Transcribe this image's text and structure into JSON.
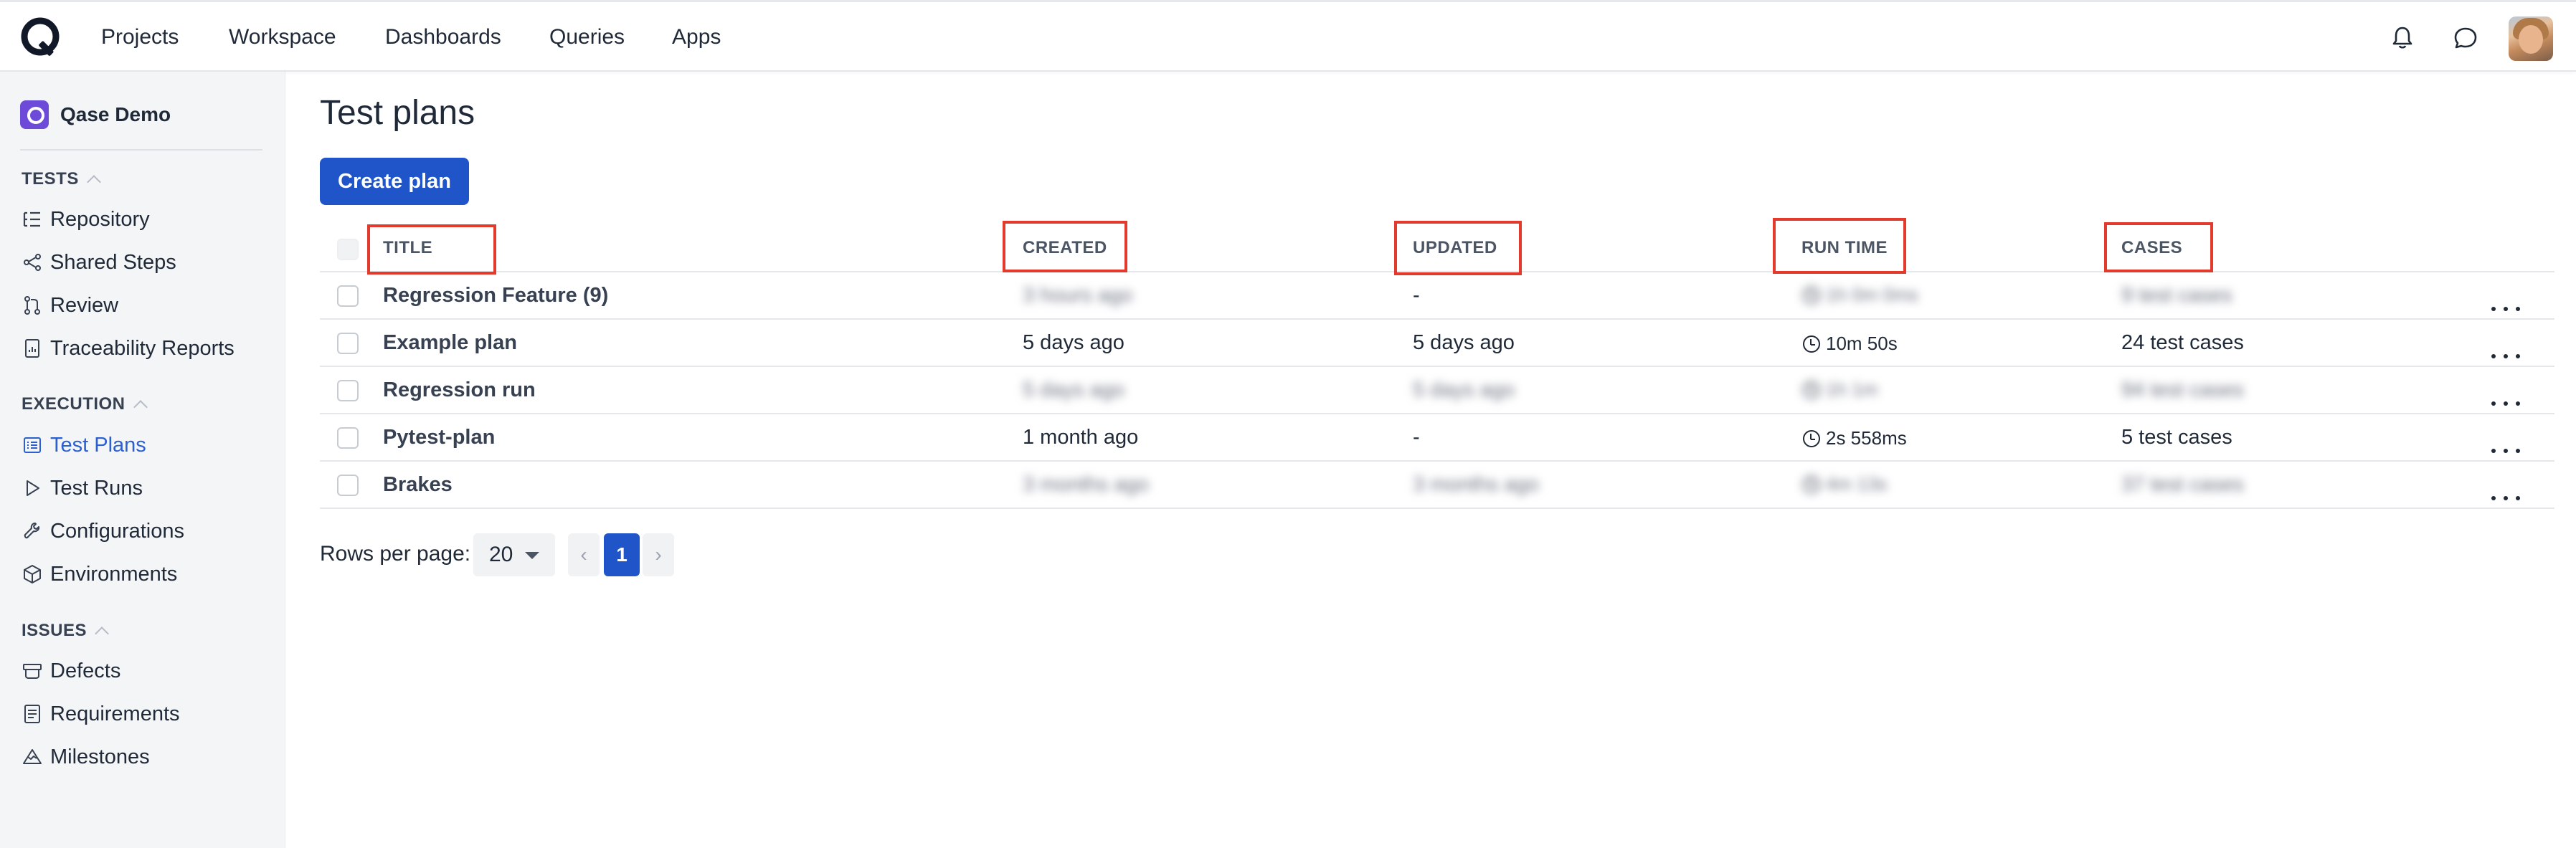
{
  "topnav": {
    "items": [
      "Projects",
      "Workspace",
      "Dashboards",
      "Queries",
      "Apps"
    ],
    "icons": [
      "logo-icon",
      "bell-icon",
      "chat-icon",
      "avatar"
    ]
  },
  "sidebar": {
    "project_name": "Qase Demo",
    "sections": [
      {
        "title": "TESTS",
        "items": [
          "Repository",
          "Shared Steps",
          "Review",
          "Traceability Reports"
        ]
      },
      {
        "title": "EXECUTION",
        "items": [
          "Test Plans",
          "Test Runs",
          "Configurations",
          "Environments"
        ]
      },
      {
        "title": "ISSUES",
        "items": [
          "Defects",
          "Requirements",
          "Milestones"
        ]
      }
    ],
    "active_item": "Test Plans",
    "active_color": "#2c5fcf"
  },
  "main": {
    "title": "Test plans",
    "create_button": "Create plan",
    "columns": [
      "TITLE",
      "CREATED",
      "UPDATED",
      "RUN TIME",
      "CASES"
    ],
    "rows": [
      {
        "title": "Regression Feature (9)",
        "created": "3 hours ago",
        "updated": "-",
        "runtime": "1h 0m 0ms",
        "cases": "9 test cases",
        "blurred": true
      },
      {
        "title": "Example plan",
        "created": "5 days ago",
        "updated": "5 days ago",
        "runtime": "10m 50s",
        "cases": "24 test cases",
        "blurred": false
      },
      {
        "title": "Regression run",
        "created": "5 days ago",
        "updated": "5 days ago",
        "runtime": "1h 1m",
        "cases": "94 test cases",
        "blurred": true
      },
      {
        "title": "Pytest-plan",
        "created": "1 month ago",
        "updated": "-",
        "runtime": "2s 558ms",
        "cases": "5 test cases",
        "blurred": false
      },
      {
        "title": "Brakes",
        "created": "3 months ago",
        "updated": "3 months ago",
        "runtime": "4m 13s",
        "cases": "37 test cases",
        "blurred": true
      }
    ]
  },
  "pagination": {
    "rows_per_page_label": "Rows per page:",
    "rows_per_page_value": "20",
    "prev": "‹",
    "current_page": "1",
    "next": "›"
  },
  "colors": {
    "accent": "#1f55c9",
    "highlight_box": "#e23b2e"
  }
}
